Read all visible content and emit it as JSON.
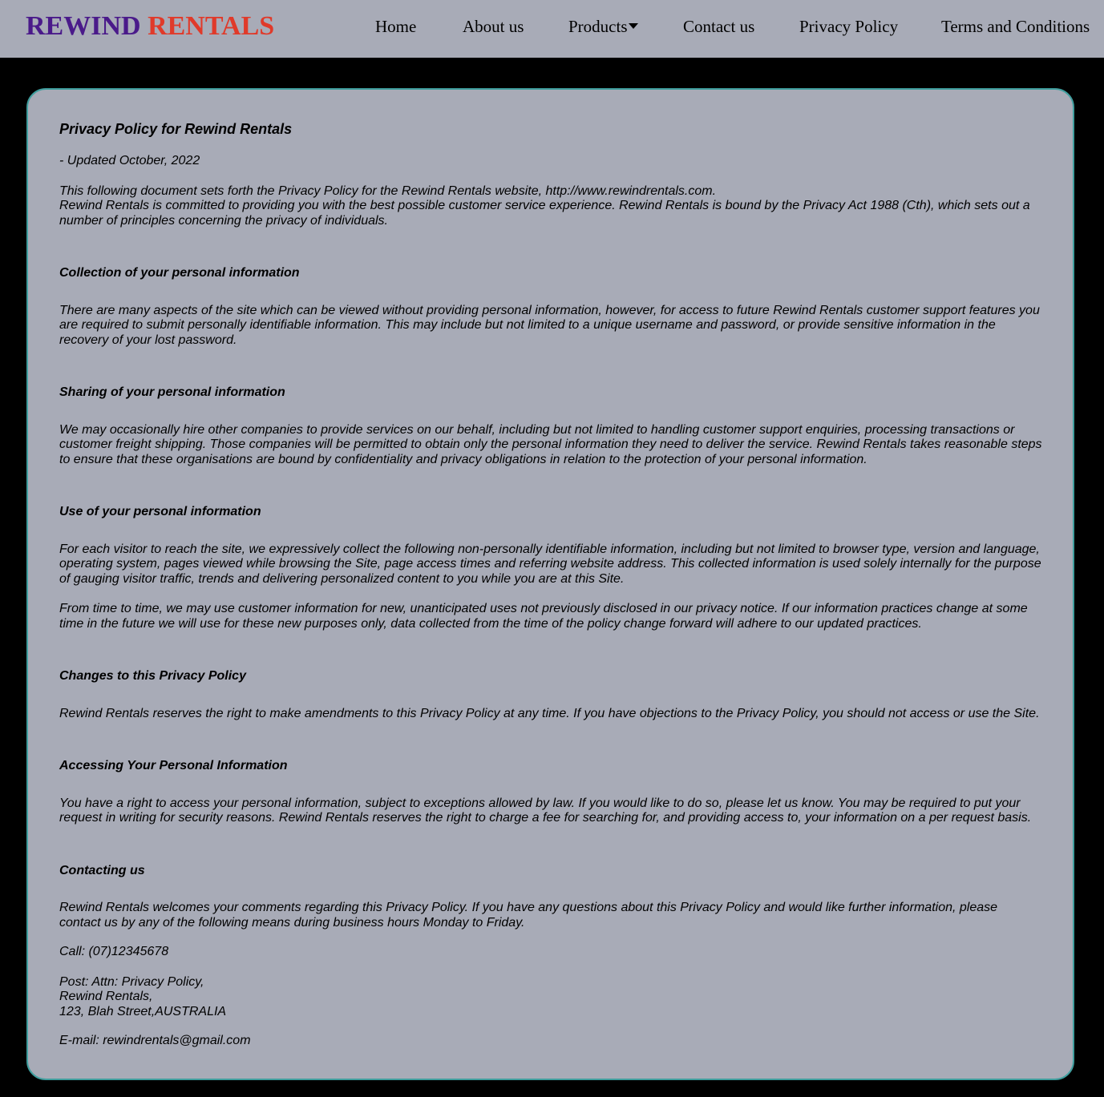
{
  "brand": {
    "word1": "REWIND",
    "word2": "RENTALS",
    "color1": "#4a1a8a",
    "color2": "#e03a2a"
  },
  "nav": {
    "home": "Home",
    "about": "About us",
    "products": "Products",
    "products_icon": "caret-down-icon",
    "contact": "Contact us",
    "privacy": "Privacy Policy",
    "terms": "Terms and Conditions"
  },
  "colors": {
    "header_bg": "#a8abb7",
    "page_bg": "#000000",
    "card_bg": "#a8abb7",
    "card_border": "#3f9e9e"
  },
  "policy": {
    "title": "Privacy Policy for Rewind Rentals",
    "updated": "- Updated October, 2022",
    "intro_line1": "This following document sets forth the Privacy Policy for the Rewind Rentals website, http://www.rewindrentals.com.",
    "intro_line2": "Rewind Rentals is committed to providing you with the best possible customer service experience. Rewind Rentals is bound by the Privacy Act 1988 (Cth), which sets out a number of principles concerning the privacy of individuals.",
    "collection_heading": "Collection of your personal information",
    "collection_text": "There are many aspects of the site which can be viewed without providing personal information, however, for access to future Rewind Rentals customer support features you are required to submit personally identifiable information. This may include but not limited to a unique username and password, or provide sensitive information in the recovery of your lost password.",
    "sharing_heading": "Sharing of your personal information",
    "sharing_text": "We may occasionally hire other companies to provide services on our behalf, including but not limited to handling customer support enquiries, processing transactions or customer freight shipping. Those companies will be permitted to obtain only the personal information they need to deliver the service. Rewind Rentals takes reasonable steps to ensure that these organisations are bound by confidentiality and privacy obligations in relation to the protection of your personal information.",
    "use_heading": "Use of your personal information",
    "use_text1": "For each visitor to reach the site, we expressively collect the following non-personally identifiable information, including but not limited to browser type, version and language, operating system, pages viewed while browsing the Site, page access times and referring website address. This collected information is used solely internally for the purpose of gauging visitor traffic, trends and delivering personalized content to you while you are at this Site.",
    "use_text2": "From time to time, we may use customer information for new, unanticipated uses not previously disclosed in our privacy notice. If our information practices change at some time in the future we will use for these new purposes only, data collected from the time of the policy change forward will adhere to our updated practices.",
    "changes_heading": "Changes to this Privacy Policy",
    "changes_text": "Rewind Rentals reserves the right to make amendments to this Privacy Policy at any time. If you have objections to the Privacy Policy, you should not access or use the Site.",
    "access_heading": "Accessing Your Personal Information",
    "access_text": "You have a right to access your personal information, subject to exceptions allowed by law. If you would like to do so, please let us know. You may be required to put your request in writing for security reasons. Rewind Rentals reserves the right to charge a fee for searching for, and providing access to, your information on a per request basis.",
    "contact_heading": "Contacting us",
    "contact_text": "Rewind Rentals welcomes your comments regarding this Privacy Policy. If you have any questions about this Privacy Policy and would like further information, please contact us by any of the following means during business hours Monday to Friday.",
    "call": "Call: (07)12345678",
    "post_line1": "Post: Attn: Privacy Policy,",
    "post_line2": "Rewind Rentals,",
    "post_line3": "123, Blah Street,AUSTRALIA",
    "email": "E-mail: rewindrentals@gmail.com"
  }
}
